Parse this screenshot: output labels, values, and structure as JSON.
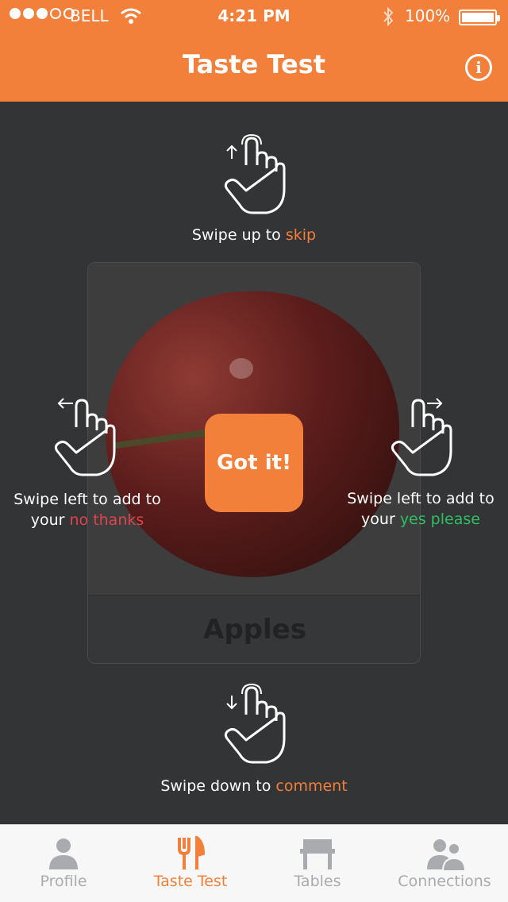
{
  "status_bar": {
    "carrier": "BELL",
    "time": "4:21 PM",
    "battery": "100%",
    "signal_filled": 3,
    "signal_total": 5
  },
  "nav": {
    "title": "Taste Test",
    "info_icon": "info-icon"
  },
  "hints": {
    "up": {
      "prefix": "Swipe up to ",
      "action": "skip"
    },
    "left": {
      "line1": "Swipe left to add to",
      "prefix": "your ",
      "action": "no thanks"
    },
    "right": {
      "line1": "Swipe left to add to",
      "prefix": "your ",
      "action": "yes please"
    },
    "down": {
      "prefix": "Swipe down to ",
      "action": "comment"
    }
  },
  "card": {
    "title": "Apples",
    "image": "apple-photo"
  },
  "got_it_label": "Got it!",
  "tabs": [
    {
      "label": "Profile",
      "icon": "profile-icon",
      "active": false
    },
    {
      "label": "Taste Test",
      "icon": "fork-knife-icon",
      "active": true
    },
    {
      "label": "Tables",
      "icon": "table-icon",
      "active": false
    },
    {
      "label": "Connections",
      "icon": "connections-icon",
      "active": false
    }
  ],
  "colors": {
    "accent": "#f27f3a",
    "background": "#333435",
    "no_thanks": "#e0434b",
    "yes_please": "#2fbf62",
    "tab_inactive": "#a9abae"
  }
}
